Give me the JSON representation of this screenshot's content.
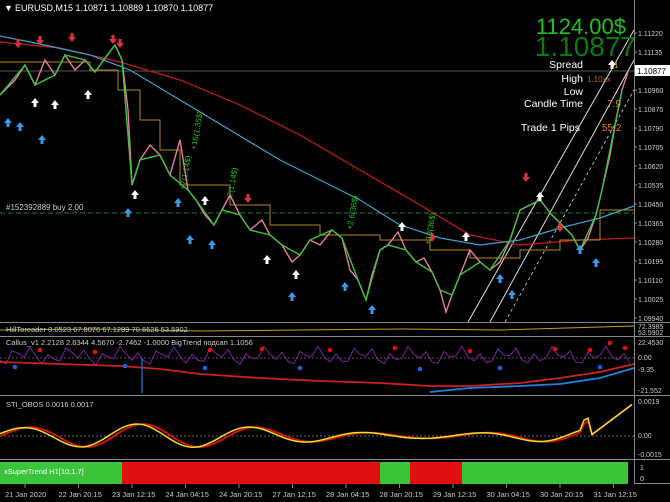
{
  "symbol_header": "EURUSD,M15  1.10871 1.10889 1.10870 1.10877",
  "menu_arrow": "▼",
  "big_balance": "1124.00$",
  "big_price": "1.10877",
  "info_panel": {
    "spread_label": "Spread",
    "spread_value": "1",
    "high_label": "High",
    "high_value": "1.10xx",
    "low_label": "Low",
    "low_value": "",
    "candle_time_label": "Candle Time",
    "candle_time_value": "7:9",
    "trade_pips_label": "Trade 1 Pips",
    "trade_pips_value": "55.2"
  },
  "order_label": "#152392889 buy 2.00",
  "current_price_tag": "1.10877",
  "price_axis": [
    "1.11220",
    "1.11135",
    "1.11045",
    "1.10960",
    "1.10875",
    "1.10790",
    "1.10705",
    "1.10620",
    "1.10535",
    "1.10450",
    "1.10365",
    "1.10280",
    "1.10195",
    "1.10110",
    "1.10025",
    "1.09940"
  ],
  "chart_annotations": [
    "+16(1.35$)",
    "+7(1.14$)",
    "-7(1.14$)",
    "+2.6(36$)",
    "+18(36$)"
  ],
  "sub1": {
    "title": "HillToreader 0.0523 67.8076 67.1289 70.6626 53.5902",
    "axis_top": "72.3985",
    "axis_bottom": "53.5902"
  },
  "sub2": {
    "title": "Callus_v1 2.2128 2.6344 4.5670 -2.7462 -1.0000  BigTrend подсап 1.1056",
    "axis": [
      "22.4530",
      "0.00",
      "-9.35",
      "-21.552"
    ]
  },
  "sub3": {
    "title": "STI_OBOS 0.0016 0.0017",
    "axis": [
      "0.0019",
      "0.00",
      "-0.0015"
    ]
  },
  "sub4": {
    "title": "xSuperTrend H1[10;1.7]",
    "axis": [
      "1",
      "0"
    ]
  },
  "time_axis": [
    "21 Jan 2020",
    "22 Jan 20:15",
    "23 Jan 12:15",
    "24 Jan 04:15",
    "24 Jan 20:15",
    "27 Jan 12:15",
    "28 Jan 04:15",
    "28 Jan 20:15",
    "29 Jan 12:15",
    "30 Jan 04:15",
    "30 Jan 20:15",
    "31 Jan 12:15"
  ],
  "colors": {
    "bg": "#000000",
    "bull": "#3ac43a",
    "bear": "#e87ba8",
    "ma_red": "#c81a1a",
    "ma_blue": "#3aa0d0",
    "accent": "#22c022",
    "supertrend_red": "#e01010",
    "supertrend_green": "#3ac43a"
  }
}
